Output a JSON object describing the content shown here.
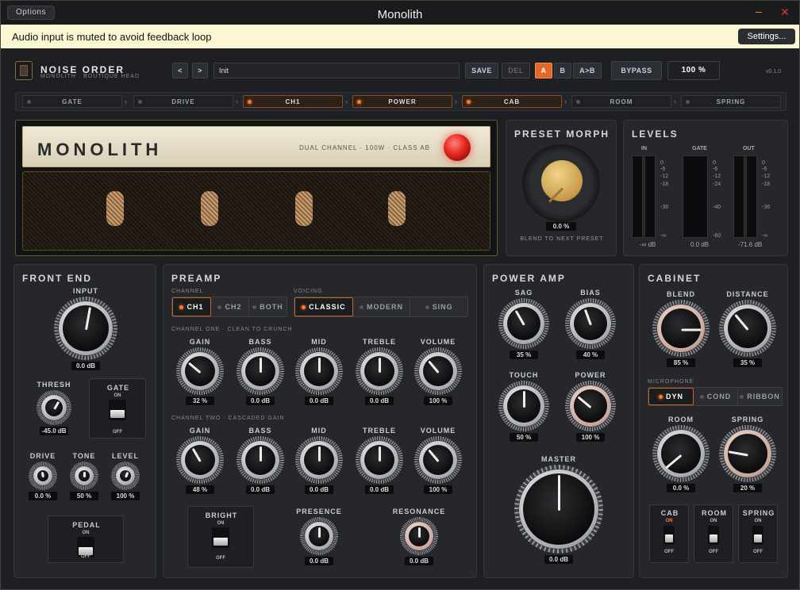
{
  "window": {
    "title": "Monolith",
    "options_label": "Options"
  },
  "notice": {
    "text": "Audio input is muted to avoid feedback loop",
    "button": "Settings..."
  },
  "header": {
    "brand": "NOISE ORDER",
    "subtitle": "MONOLITH · BOUTIQUE HEAD",
    "prev": "<",
    "next": ">",
    "preset": "Init",
    "save": "SAVE",
    "del": "DEL",
    "a": "A",
    "b": "B",
    "ab": "A>B",
    "bypass": "BYPASS",
    "mix": "100 %",
    "version": "v0.1.0"
  },
  "chain": [
    {
      "label": "GATE",
      "active": false
    },
    {
      "label": "DRIVE",
      "active": false
    },
    {
      "label": "CH1",
      "active": true
    },
    {
      "label": "POWER",
      "active": true
    },
    {
      "label": "CAB",
      "active": true
    },
    {
      "label": "ROOM",
      "active": false
    },
    {
      "label": "SPRING",
      "active": false
    }
  ],
  "amp": {
    "name": "MONOLITH",
    "spec": "DUAL CHANNEL · 100W · CLASS AB"
  },
  "morph": {
    "title": "PRESET MORPH",
    "value": "0.0 %",
    "caption": "BLEND TO NEXT PRESET"
  },
  "levels": {
    "title": "LEVELS",
    "in": "IN",
    "gate": "GATE",
    "out": "OUT",
    "in_val": "-∞ dB",
    "gate_val": "0.0 dB",
    "out_val": "-71.6 dB",
    "in_ticks": [
      "0",
      "-6",
      "-12",
      "-18",
      "-36",
      "-∞"
    ],
    "gate_ticks": [
      "0",
      "-6",
      "-12",
      "-24",
      "-40",
      "-60"
    ],
    "out_ticks": [
      "0",
      "-6",
      "-12",
      "-18",
      "-36",
      "-∞"
    ]
  },
  "front": {
    "title": "FRONT END",
    "input": "INPUT",
    "input_val": "0.0 dB",
    "thresh": "THRESH",
    "thresh_val": "-45.0 dB",
    "gate": "GATE",
    "on": "ON",
    "off": "OFF",
    "drive": "DRIVE",
    "drive_val": "0.0 %",
    "tone": "TONE",
    "tone_val": "50 %",
    "level": "LEVEL",
    "level_val": "100 %",
    "pedal": "PEDAL"
  },
  "preamp": {
    "title": "PREAMP",
    "channel_label": "CHANNEL",
    "channels": [
      "CH1",
      "CH2",
      "BOTH"
    ],
    "voicing_label": "VOICING",
    "voicings": [
      "CLASSIC",
      "MODERN",
      "SING"
    ],
    "ch1_label": "CHANNEL ONE · CLEAN TO CRUNCH",
    "ch2_label": "CHANNEL TWO · CASCADED GAIN",
    "ch1": [
      {
        "n": "GAIN",
        "v": "32 %"
      },
      {
        "n": "BASS",
        "v": "0.0 dB"
      },
      {
        "n": "MID",
        "v": "0.0 dB"
      },
      {
        "n": "TREBLE",
        "v": "0.0 dB"
      },
      {
        "n": "VOLUME",
        "v": "100 %"
      }
    ],
    "ch2": [
      {
        "n": "GAIN",
        "v": "48 %"
      },
      {
        "n": "BASS",
        "v": "0.0 dB"
      },
      {
        "n": "MID",
        "v": "0.0 dB"
      },
      {
        "n": "TREBLE",
        "v": "0.0 dB"
      },
      {
        "n": "VOLUME",
        "v": "100 %"
      }
    ],
    "bright": "BRIGHT",
    "presence": "PRESENCE",
    "presence_val": "0.0 dB",
    "resonance": "RESONANCE",
    "resonance_val": "0.0 dB"
  },
  "power": {
    "title": "POWER AMP",
    "sag": "SAG",
    "sag_val": "35 %",
    "bias": "BIAS",
    "bias_val": "40 %",
    "touch": "TOUCH",
    "touch_val": "50 %",
    "power": "POWER",
    "power_val": "100 %",
    "master": "MASTER",
    "master_val": "0.0 dB"
  },
  "cab": {
    "title": "CABINET",
    "blend": "BLEND",
    "blend_val": "85 %",
    "distance": "DISTANCE",
    "distance_val": "35 %",
    "mic_label": "MICROPHONE",
    "mics": [
      "DYN",
      "COND",
      "RIBBON"
    ],
    "room": "ROOM",
    "room_val": "0.0 %",
    "spring": "SPRING",
    "spring_val": "20 %",
    "cab_sw": "CAB",
    "room_sw": "ROOM",
    "spring_sw": "SPRING"
  },
  "colors": {
    "accent": "#ff7a2e",
    "jewel": "#e8261d",
    "knob_gold": "#d8b46a"
  }
}
